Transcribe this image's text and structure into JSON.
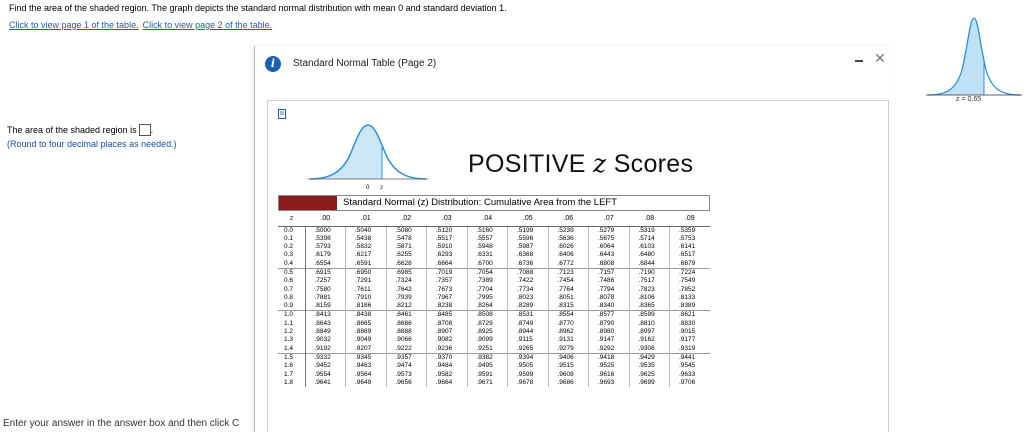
{
  "problem": {
    "instruction": "Find the area of the shaded region. The graph depicts the standard normal distribution with mean 0 and standard deviation 1.",
    "link_page1": "Click to view page 1 of the table.",
    "link_page2": "Click to view page 2 of the table.",
    "answer_prefix": "The area of the shaded region is",
    "answer_value": "",
    "answer_suffix": ".",
    "round_note": "(Round to four decimal places as needed.)",
    "footer": "Enter your answer in the answer box and then click C"
  },
  "graph": {
    "z_label": "z = 0.65"
  },
  "modal": {
    "title": "Standard Normal Table (Page 2)",
    "close_symbol": "✕",
    "heading_main": "POSITIVE ",
    "heading_z": "z",
    "heading_rest": " Scores",
    "bell_zero": "0",
    "bell_z": "z",
    "table_title": "Standard Normal (z) Distribution: Cumulative Area from the LEFT"
  },
  "table": {
    "headers": [
      "z",
      ".00",
      ".01",
      ".02",
      ".03",
      ".04",
      ".05",
      ".06",
      ".07",
      ".08",
      ".09"
    ],
    "rows": [
      [
        "0.0",
        ".5000",
        ".5040",
        ".5080",
        ".5120",
        ".5160",
        ".5199",
        ".5239",
        ".5279",
        ".5319",
        ".5359"
      ],
      [
        "0.1",
        ".5398",
        ".5438",
        ".5478",
        ".5517",
        ".5557",
        ".5596",
        ".5636",
        ".5675",
        ".5714",
        ".5753"
      ],
      [
        "0.2",
        ".5793",
        ".5832",
        ".5871",
        ".5910",
        ".5948",
        ".5987",
        ".6026",
        ".6064",
        ".6103",
        ".6141"
      ],
      [
        "0.3",
        ".6179",
        ".6217",
        ".6255",
        ".6293",
        ".6331",
        ".6368",
        ".6406",
        ".6443",
        ".6480",
        ".6517"
      ],
      [
        "0.4",
        ".6554",
        ".6591",
        ".6628",
        ".6664",
        ".6700",
        ".6736",
        ".6772",
        ".6808",
        ".6844",
        ".6879"
      ],
      [
        "0.5",
        ".6915",
        ".6950",
        ".6985",
        ".7019",
        ".7054",
        ".7088",
        ".7123",
        ".7157",
        ".7190",
        ".7224"
      ],
      [
        "0.6",
        ".7257",
        ".7291",
        ".7324",
        ".7357",
        ".7389",
        ".7422",
        ".7454",
        ".7486",
        ".7517",
        ".7549"
      ],
      [
        "0.7",
        ".7580",
        ".7611",
        ".7642",
        ".7673",
        ".7704",
        ".7734",
        ".7764",
        ".7794",
        ".7823",
        ".7852"
      ],
      [
        "0.8",
        ".7881",
        ".7910",
        ".7939",
        ".7967",
        ".7995",
        ".8023",
        ".8051",
        ".8078",
        ".8106",
        ".8133"
      ],
      [
        "0.9",
        ".8159",
        ".8186",
        ".8212",
        ".8238",
        ".8264",
        ".8289",
        ".8315",
        ".8340",
        ".8365",
        ".8389"
      ],
      [
        "1.0",
        ".8413",
        ".8438",
        ".8461",
        ".8485",
        ".8508",
        ".8531",
        ".8554",
        ".8577",
        ".8599",
        ".8621"
      ],
      [
        "1.1",
        ".8643",
        ".8665",
        ".8686",
        ".8708",
        ".8729",
        ".8749",
        ".8770",
        ".8790",
        ".8810",
        ".8830"
      ],
      [
        "1.2",
        ".8849",
        ".8869",
        ".8888",
        ".8907",
        ".8925",
        ".8944",
        ".8962",
        ".8980",
        ".8997",
        ".9015"
      ],
      [
        "1.3",
        ".9032",
        ".9049",
        ".9066",
        ".9082",
        ".9099",
        ".9115",
        ".9131",
        ".9147",
        ".9162",
        ".9177"
      ],
      [
        "1.4",
        ".9192",
        ".9207",
        ".9222",
        ".9236",
        ".9251",
        ".9265",
        ".9279",
        ".9292",
        ".9306",
        ".9319"
      ],
      [
        "1.5",
        ".9332",
        ".9345",
        ".9357",
        ".9370",
        ".9382",
        ".9394",
        ".9406",
        ".9418",
        ".9429",
        ".9441"
      ],
      [
        "1.6",
        ".9452",
        ".9463",
        ".9474",
        ".9484",
        ".9495",
        ".9505",
        ".9515",
        ".9525",
        ".9535",
        ".9545"
      ],
      [
        "1.7",
        ".9554",
        ".9564",
        ".9573",
        ".9582",
        ".9591",
        ".9599",
        ".9608",
        ".9616",
        ".9625",
        ".9633"
      ],
      [
        "1.8",
        ".9641",
        ".9649",
        ".9656",
        ".9664",
        ".9671",
        ".9678",
        ".9686",
        ".9693",
        ".9699",
        ".9706"
      ]
    ]
  },
  "colors": {
    "link": "#1a5fb4",
    "curve": "#2f8fd6",
    "shade": "#bfe0f5",
    "strip": "#8b1c1c"
  },
  "icons": [
    "info-icon",
    "minimize-icon",
    "close-icon",
    "document-icon"
  ]
}
